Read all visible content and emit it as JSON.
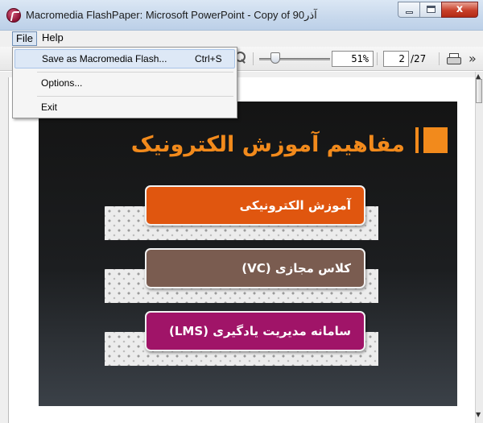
{
  "window": {
    "title": "Macromedia FlashPaper: Microsoft PowerPoint - Copy of 90آذر",
    "close_glyph": "x"
  },
  "menubar": {
    "items": [
      {
        "label": "File",
        "active": true
      },
      {
        "label": "Help",
        "active": false
      }
    ]
  },
  "file_menu": {
    "items": [
      {
        "label": "Save as Macromedia Flash...",
        "shortcut": "Ctrl+S"
      },
      {
        "label": "Options...",
        "shortcut": ""
      },
      {
        "label": "Exit",
        "shortcut": ""
      }
    ]
  },
  "toolbar": {
    "zoom_value": "51%",
    "zoom_percent": 51,
    "current_page": "2",
    "total_pages": "/27",
    "more_glyph": "»"
  },
  "slide": {
    "title": "مفاهیم آموزش الکترونیک",
    "items": [
      {
        "label": "آموزش الکترونیکی",
        "color": "#e0560f"
      },
      {
        "label": "کلاس مجازی (VC)",
        "color": "#7a5c50"
      },
      {
        "label": "سامانه مدیریت یادگیری (LMS)",
        "color": "#a01468"
      }
    ],
    "accent_color": "#f28a1c"
  },
  "icons": {
    "app": "flashpaper-logo-icon",
    "zoom": "magnifier-icon",
    "print": "printer-icon",
    "more": "chevron-double-right-icon"
  }
}
